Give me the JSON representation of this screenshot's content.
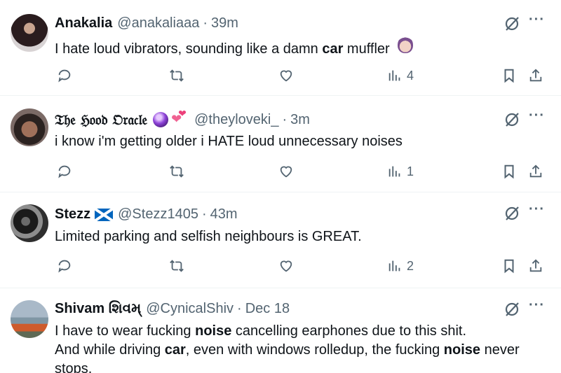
{
  "tweets": [
    {
      "name": "Anakalia",
      "handle": "@anakaliaaa",
      "separator": "·",
      "time": "39m",
      "text_parts": [
        "I hate loud vibrators, sounding like a damn ",
        "car",
        " muffler"
      ],
      "emoji": "facepalm-emoji",
      "views": "4"
    },
    {
      "name": "𝔗𝔥𝔢 ℌ𝔬𝔬𝔡 𝔒𝔯𝔞𝔠𝔩𝔢",
      "handle": "@theyloveki_",
      "separator": "·",
      "time": "3m",
      "text": "i know i'm getting older i HATE loud unnecessary noises",
      "emoji": [
        "crystal-ball-emoji",
        "two-hearts-emoji"
      ],
      "views": "1"
    },
    {
      "name": "Stezz",
      "handle": "@Stezz1405",
      "separator": "·",
      "time": "43m",
      "text": "Limited parking and selfish neighbours is GREAT.",
      "emoji": "scotland-flag-emoji",
      "views": "2"
    },
    {
      "name": "Shivam શિવમ્",
      "handle": "@CynicalShiv",
      "separator": "·",
      "time": "Dec 18",
      "text_parts": [
        "I have to wear fucking ",
        "noise",
        " cancelling earphones due to this shit.",
        "And while driving ",
        "car",
        ", even with windows rolledup, the fucking ",
        "noise",
        " never stops."
      ]
    }
  ],
  "icons": {
    "reply": "reply-icon",
    "retweet": "retweet-icon",
    "like": "heart-icon",
    "views": "views-icon",
    "bookmark": "bookmark-icon",
    "share": "share-icon",
    "grok": "grok-icon",
    "more": "more-icon"
  },
  "colors": {
    "text": "#0f1419",
    "secondary": "#536471",
    "divider": "#eff3f4"
  }
}
